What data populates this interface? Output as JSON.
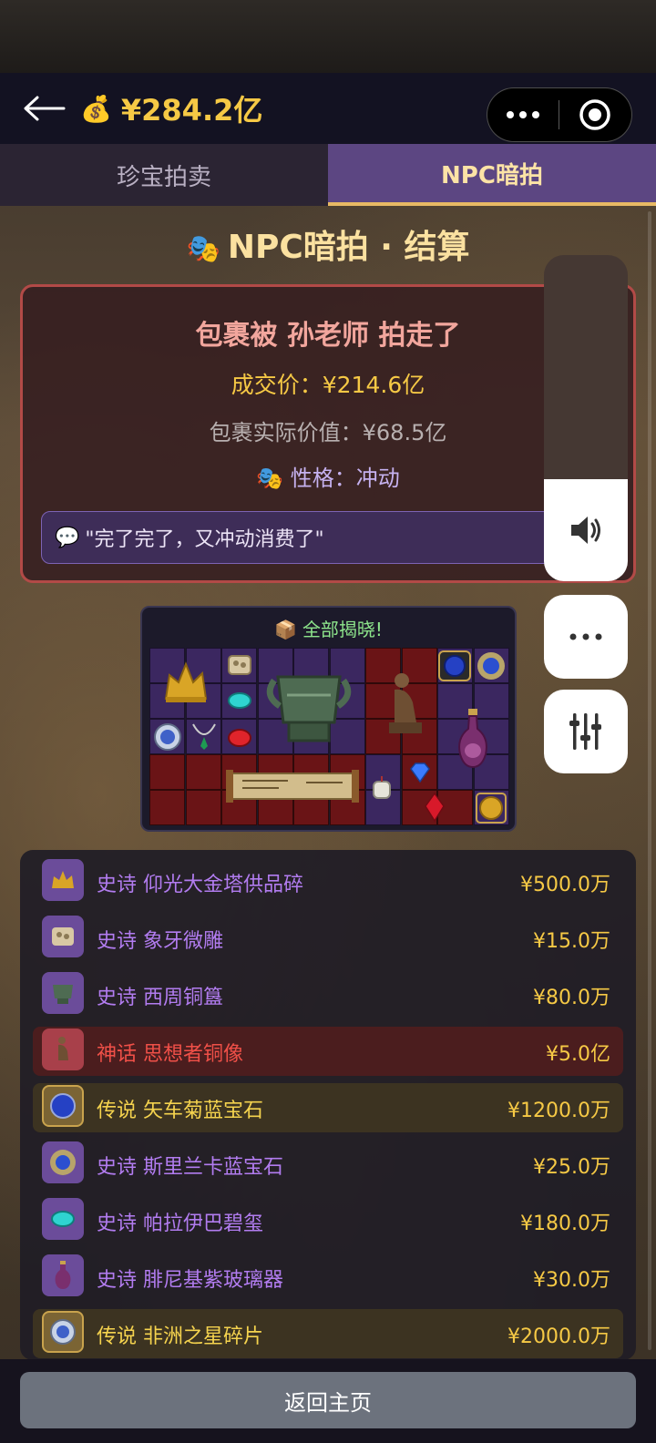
{
  "header": {
    "money_icon": "money-bag-icon",
    "balance": "¥284.2亿"
  },
  "tabs": [
    {
      "label": "珍宝拍卖",
      "active": false
    },
    {
      "label": "NPC暗拍",
      "active": true
    }
  ],
  "settlement": {
    "title": "NPC暗拍 · 结算",
    "winner_text": "包裹被 孙老师 拍走了",
    "deal_price": "成交价：¥214.6亿",
    "actual_value": "包裹实际价值：¥68.5亿",
    "personality": "性格：冲动",
    "quote": "\"完了完了，又冲动消费了\""
  },
  "reveal": {
    "title": "全部揭晓!"
  },
  "items": [
    {
      "tier": "epic",
      "name": "史诗 仰光大金塔供品碎",
      "price": "¥500.0万",
      "icon": "gold-fragment-icon"
    },
    {
      "tier": "epic",
      "name": "史诗 象牙微雕",
      "price": "¥15.0万",
      "icon": "ivory-carving-icon"
    },
    {
      "tier": "epic",
      "name": "史诗 西周铜簋",
      "price": "¥80.0万",
      "icon": "bronze-vessel-icon"
    },
    {
      "tier": "mythic",
      "name": "神话 思想者铜像",
      "price": "¥5.0亿",
      "icon": "thinker-statue-icon"
    },
    {
      "tier": "legend",
      "name": "传说 矢车菊蓝宝石",
      "price": "¥1200.0万",
      "icon": "blue-sapphire-icon"
    },
    {
      "tier": "epic",
      "name": "史诗 斯里兰卡蓝宝石",
      "price": "¥25.0万",
      "icon": "sapphire-brooch-icon"
    },
    {
      "tier": "epic",
      "name": "史诗 帕拉伊巴碧玺",
      "price": "¥180.0万",
      "icon": "paraiba-tourmaline-icon"
    },
    {
      "tier": "epic",
      "name": "史诗 腓尼基紫玻璃器",
      "price": "¥30.0万",
      "icon": "purple-glass-vase-icon"
    },
    {
      "tier": "legend",
      "name": "传说 非洲之星碎片",
      "price": "¥2000.0万",
      "icon": "star-of-africa-icon"
    }
  ],
  "footer": {
    "home_label": "返回主页"
  },
  "colors": {
    "gold": "#f6c945",
    "epic": "#b27cf0",
    "mythic": "#f05048",
    "legend": "#f5d34e",
    "active_tab": "#5c4682"
  }
}
